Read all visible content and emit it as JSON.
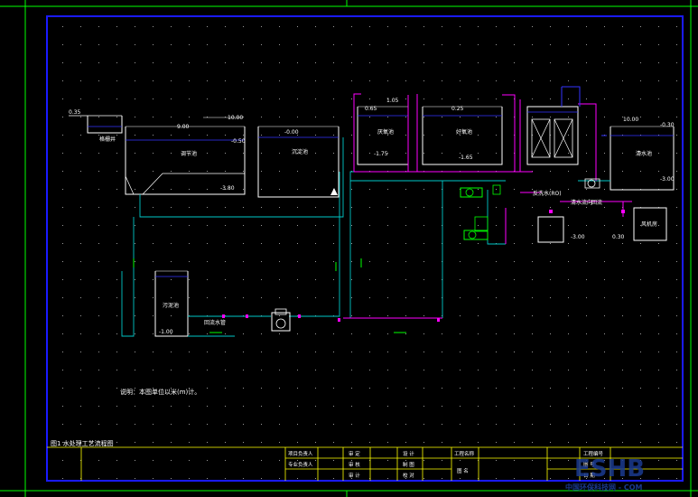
{
  "colors": {
    "background": "#000000",
    "frame_outer": "#00ff00",
    "frame_inner": "#1a1aff",
    "tank": "#ffffff",
    "water": "#3333ff",
    "pipe_cyan": "#00c8c8",
    "pipe_magenta": "#ff00ff",
    "pipe_green": "#00ff00",
    "accent_yellow": "#ffff00",
    "watermark": "#1a3a8f"
  },
  "elevations": {
    "e1": "0.35",
    "e2": "9.00",
    "e3": "10.00",
    "e4": "-0.50",
    "e5": "-3.80",
    "e6": "-0.00",
    "e7": "0.65",
    "e8": "1.05",
    "e9": "-1.75",
    "e10": "0.25",
    "e11": "-1.65",
    "e12": "10.00",
    "e13": "-0.30",
    "e14": "-3.00",
    "e15": "-3.00",
    "e16": "0.30",
    "e17": "-1.00"
  },
  "labels": {
    "t_grid": "格栅井",
    "t_reg": "调节池",
    "t_sed": "沉淀池",
    "t_bio1": "厌氧池",
    "t_bio2": "好氧池",
    "t_clear": "清水池",
    "t_sludge": "污泥池",
    "t_dose": "加药装置",
    "t_filter_note": "反洗水(RO)",
    "t_chem_flow": "清水流向",
    "t_chem_flow2": "回流",
    "t_blower": "风机房",
    "t_pump": "提升泵",
    "t_return": "回流水管"
  },
  "notes": {
    "description": "说明：本图单位以米(m)计。",
    "title_strip": "图1 水处理工艺流程图"
  },
  "title_block": {
    "r1c1": "项目负责人",
    "r1c2": "审  定",
    "r1c3": "设  计",
    "r1c4": "工程名称",
    "r1c5": "",
    "r1c6": "工程编号",
    "r2c1": "专业负责人",
    "r2c2": "审  核",
    "r2c3": "制  图",
    "r2c4": "图  名",
    "r2c6": "图  号",
    "r3c1": "",
    "r3c2": "审  计",
    "r3c3": "校  对",
    "r3c6": "日  期"
  },
  "watermark": {
    "logo": "ESHB",
    "site": "中国环保科技网 - COM"
  }
}
